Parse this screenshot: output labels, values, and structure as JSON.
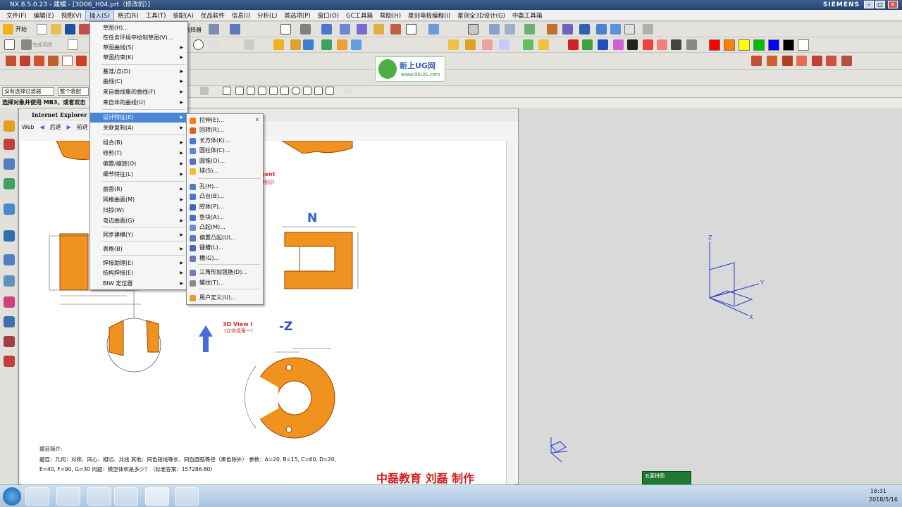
{
  "window": {
    "title": "NX 8.5.0.23 - 建模 - [3D06_H04.prt（修改的）]",
    "brand": "SIEMENS",
    "controls": [
      "–",
      "□",
      "✕"
    ]
  },
  "menubar": [
    "文件(F)",
    "编辑(E)",
    "视图(V)",
    "插入(S)",
    "格式(R)",
    "工具(T)",
    "装配(A)",
    "优品软件",
    "信息(I)",
    "分析(L)",
    "首选项(P)",
    "窗口(O)",
    "GC工具箱",
    "帮助(H)",
    "星创电极编程(I)",
    "星创全3D设计(G)",
    "中磊工具箱"
  ],
  "toolbar": {
    "start": "开始",
    "sketch": "完成草图",
    "selector": "选择器",
    "filter_value": "没有选择过滤器",
    "scope_value": "整个装配"
  },
  "watermark": {
    "text": "新上UG网",
    "url": "www.9SUG.com"
  },
  "colors": {
    "swatches_row1": [
      "#ff0000",
      "#ff7f00",
      "#ffff00",
      "#00c000",
      "#0000ff",
      "#000000",
      "#ffffff"
    ],
    "swatches_row3": [
      "#ff0000",
      "#ff00ff",
      "#ffff00",
      "#00ffff",
      "#0080ff",
      "#8040c0",
      "#a05030",
      "#000000",
      "#e080c0",
      "#d06040",
      "#f0a040",
      "#a0d060",
      "#60c060",
      "#40b0a0",
      "#40a0e0",
      "#4070d0",
      "#b07040"
    ]
  },
  "cue": "选择对象并使用 MB3，或者双击",
  "insert_menu": [
    {
      "label": "草图(H)...",
      "arrow": false
    },
    {
      "label": "在任务环境中绘制草图(V)...",
      "arrow": false
    },
    {
      "label": "草图曲线(S)",
      "arrow": true
    },
    {
      "label": "草图约束(K)",
      "arrow": true
    },
    {
      "label": "基准/点(D)",
      "arrow": true
    },
    {
      "label": "曲线(C)",
      "arrow": true
    },
    {
      "label": "来自曲线集的曲线(F)",
      "arrow": true
    },
    {
      "label": "来自体的曲线(U)",
      "arrow": true
    },
    {
      "label": "设计特征(E)",
      "arrow": true
    },
    {
      "label": "关联复制(A)",
      "arrow": true
    },
    {
      "label": "组合(B)",
      "arrow": true
    },
    {
      "label": "修剪(T)",
      "arrow": true
    },
    {
      "label": "偏置/缩放(O)",
      "arrow": true
    },
    {
      "label": "细节特征(L)",
      "arrow": true
    },
    {
      "label": "曲面(R)",
      "arrow": true
    },
    {
      "label": "网格曲面(M)",
      "arrow": true
    },
    {
      "label": "扫掠(W)",
      "arrow": true
    },
    {
      "label": "弯边曲面(G)",
      "arrow": true
    },
    {
      "label": "同步建模(Y)",
      "arrow": true
    },
    {
      "label": "表格(B)",
      "arrow": true
    },
    {
      "label": "焊接助理(E)",
      "arrow": true
    },
    {
      "label": "结构焊接(E)",
      "arrow": true
    },
    {
      "label": "BIW 定位器",
      "arrow": true
    }
  ],
  "design_menu": [
    {
      "label": "拉伸(E)...",
      "shortcut": "X"
    },
    {
      "label": "回转(R)...",
      "shortcut": ""
    },
    {
      "label": "长方体(K)...",
      "shortcut": ""
    },
    {
      "label": "圆柱体(C)...",
      "shortcut": ""
    },
    {
      "label": "圆锥(O)...",
      "shortcut": ""
    },
    {
      "label": "球(S)...",
      "shortcut": ""
    },
    {
      "label": "孔(H)...",
      "shortcut": ""
    },
    {
      "label": "凸台(B)...",
      "shortcut": ""
    },
    {
      "label": "腔体(P)...",
      "shortcut": ""
    },
    {
      "label": "垫块(A)...",
      "shortcut": ""
    },
    {
      "label": "凸起(M)...",
      "shortcut": ""
    },
    {
      "label": "偏置凸起(U)...",
      "shortcut": ""
    },
    {
      "label": "键槽(L)...",
      "shortcut": ""
    },
    {
      "label": "槽(G)...",
      "shortcut": ""
    },
    {
      "label": "三角形加强筋(D)...",
      "shortcut": ""
    },
    {
      "label": "螺纹(T)...",
      "shortcut": ""
    },
    {
      "label": "用户定义(U)...",
      "shortcut": ""
    }
  ],
  "ie": {
    "title": "Internet Explorer",
    "web": "Web",
    "back": "后退",
    "forward": "前进"
  },
  "drawing": {
    "label_N": "N",
    "label_Z": "-Z",
    "view3d": "3D View I",
    "view3d_cn": "(立体视角一)",
    "tangent": "gent",
    "tangent_cn": "(相切)",
    "footer_title": "题目简介:",
    "footer_line1": "题目：几何：对称、同心、相切、共线 其他：同色短线等长、同色圆弧等径（黑色除外） 参数：A=20, B=15, C=60, D=20,",
    "footer_line2": "E=40, F=90, G=30        问题：模型体积是多少？（标准答案：157286.80）",
    "credit": "中磊教育 刘磊 制作"
  },
  "axes": {
    "z": "Z",
    "y": "Y",
    "x": "X"
  },
  "view_widget": {
    "label": "五菱拼图"
  },
  "clock": {
    "time": "16:31",
    "date": "2018/5/16"
  }
}
